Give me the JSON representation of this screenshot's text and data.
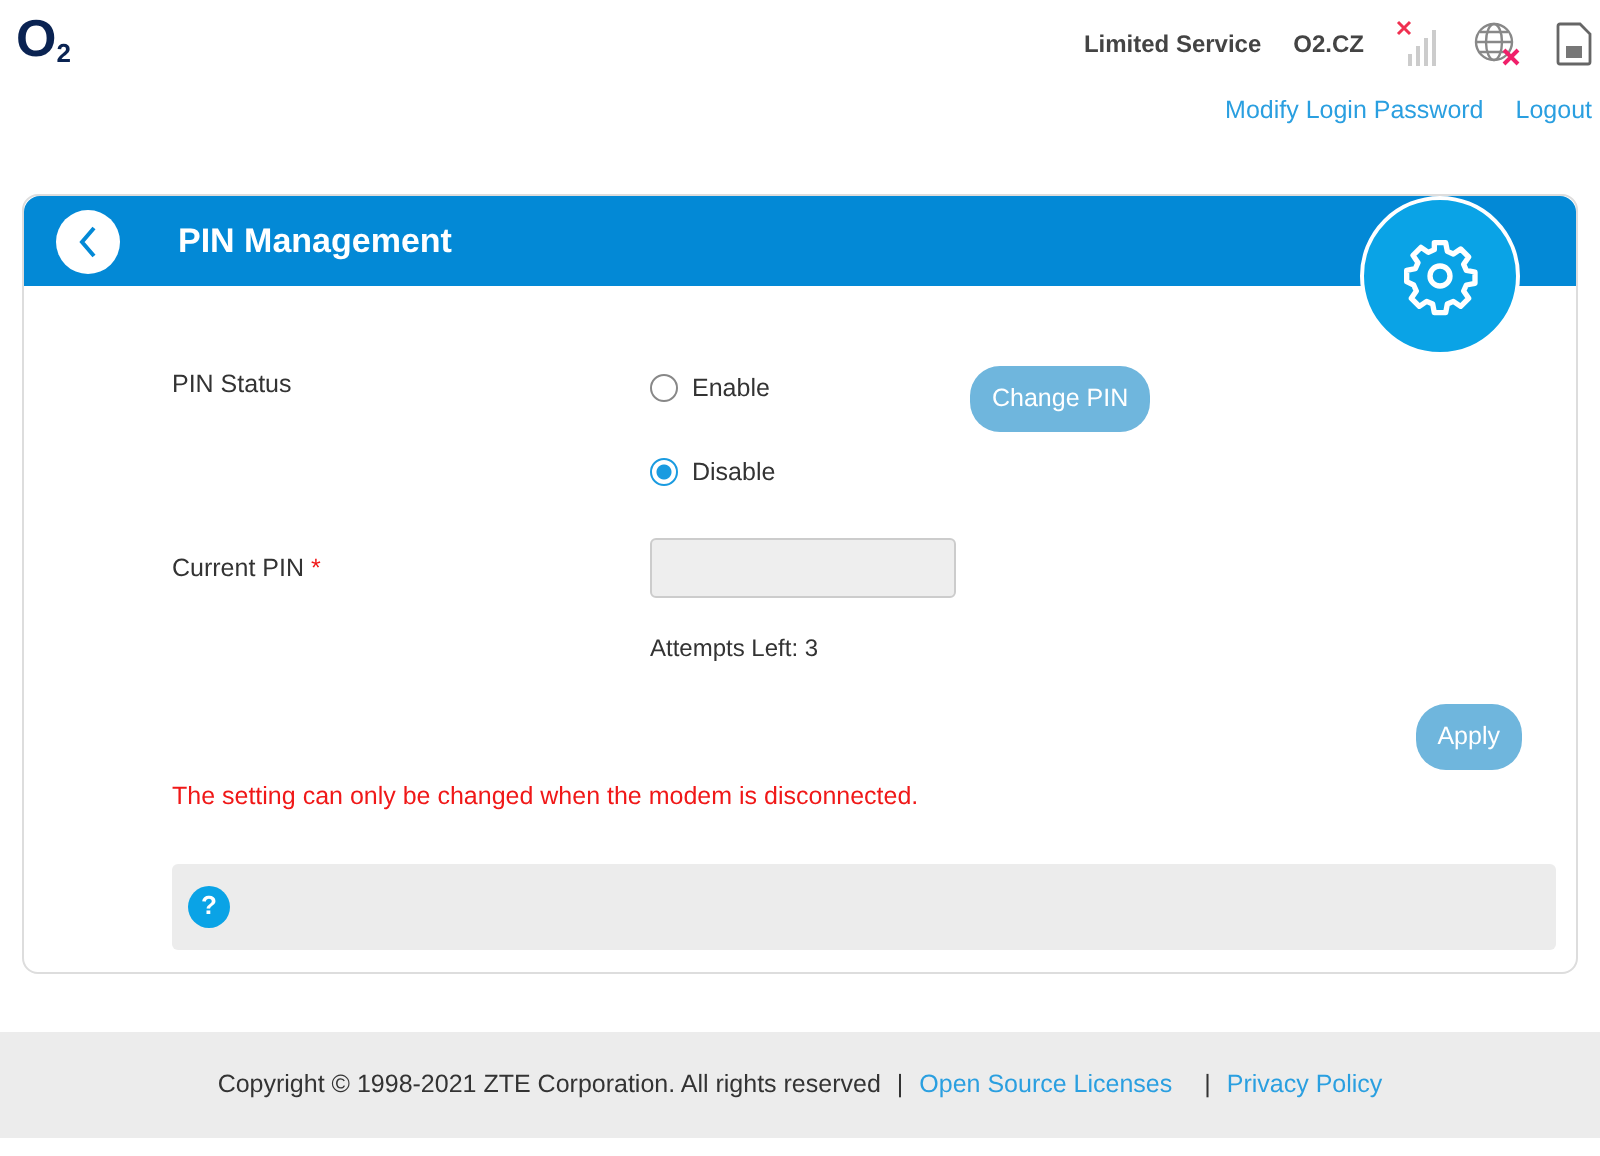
{
  "logo": "O$_{2}$",
  "status": {
    "service": "Limited Service",
    "operator": "O2.CZ"
  },
  "header_links": [
    "Modify Login Password",
    "Logout"
  ],
  "panel": {
    "title": "PIN Management"
  },
  "pin_status": {
    "label": "PIN Status",
    "options": [
      {
        "label": "Enable",
        "selected": false
      },
      {
        "label": "Disable",
        "selected": true
      }
    ],
    "button": {
      "label": "Change PIN",
      "disabled": true
    }
  },
  "current_pin": {
    "label": "Current PIN",
    "required_mark": "*",
    "attempts": "Attempts Left: 3"
  },
  "apply": {
    "label": "Apply",
    "disabled": true
  },
  "warning": "The setting can only be changed when the modem is disconnected.",
  "help": {
    "icon": "?"
  },
  "footer": {
    "copyright": "Copyright © 1998-2021 ZTE Corporation. All rights reserved",
    "separators": [
      "|",
      "|"
    ],
    "links": [
      "Open Source Licenses",
      "Privacy Policy"
    ]
  }
}
